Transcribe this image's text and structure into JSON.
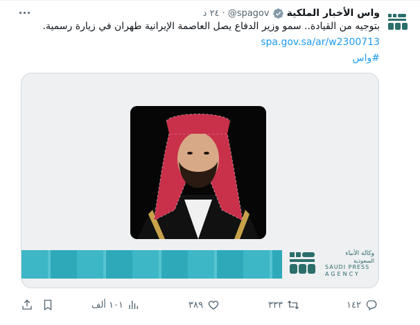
{
  "tweet": {
    "display_name": "واس الأخبار الملكية",
    "handle": "@spagov",
    "separator": "·",
    "time": "٢٤ د",
    "text": "بتوجيه من القيادة.. سمو وزير الدفاع يصل العاصمة الإيرانية طهران في زيارة رسمية.",
    "link": "spa.gov.sa/ar/w2300713",
    "hashtag": "#واس"
  },
  "avatar": {
    "label": "SPA",
    "icon": "spa-logo-icon"
  },
  "media": {
    "logo_ar_line1": "وكالة الأنباء",
    "logo_ar_line2": "السعودية",
    "logo_en_line1": "SAUDI PRESS",
    "logo_en_line2": "AGENCY",
    "logo_mark": "SPA"
  },
  "actions": {
    "replies": "١٤٢",
    "retweets": "٣٣٣",
    "likes": "٣٨٩",
    "views": "١٠١ ألف"
  },
  "colors": {
    "link": "#1d9bf0",
    "verified": "#829aab",
    "muted": "#536471",
    "banner": "#3db6c6"
  }
}
